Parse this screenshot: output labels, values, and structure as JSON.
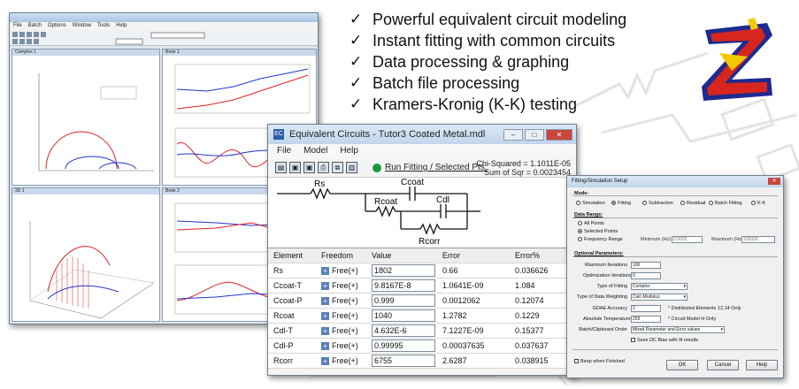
{
  "features": [
    "Powerful equivalent circuit modeling",
    "Instant fitting with common circuits",
    "Data processing & graphing",
    "Batch file processing",
    "Kramers-Kronig (K-K) testing"
  ],
  "check_glyph": "✓",
  "logo": {
    "letter": "Z",
    "colors": {
      "red": "#d7261e",
      "yellow": "#f3c900",
      "blue": "#1e2a8f"
    }
  },
  "app_window": {
    "menu": [
      "File",
      "Batch",
      "Options",
      "Window",
      "Tools",
      "Help"
    ],
    "panes": [
      "Complex 1",
      "Bode 1",
      "3D 1",
      "Bode 2"
    ]
  },
  "ec_window": {
    "title": "Equivalent Circuits - Tutor3 Coated Metal.mdl",
    "menu": [
      "File",
      "Model",
      "Help"
    ],
    "run_label": "Run Fitting / Selected Pts.",
    "chi_squared": "Chi-Squared = 1.1011E-05",
    "sum_sqr": "Sum of Sqr = 0.0023454",
    "circuit_labels": {
      "rs": "Rs",
      "ccoat": "Ccoat",
      "rcoat": "Rcoat",
      "cdl": "Cdl",
      "rcorr": "Rcorr"
    },
    "columns": [
      "Element",
      "Freedom",
      "Value",
      "Error",
      "Error%"
    ],
    "rows": [
      {
        "element": "Rs",
        "freedom": "Free(+)",
        "value": "1802",
        "error": "0.66",
        "error_pct": "0.036626"
      },
      {
        "element": "Ccoat-T",
        "freedom": "Free(+)",
        "value": "9.8167E-8",
        "error": "1.0641E-09",
        "error_pct": "1.084"
      },
      {
        "element": "Ccoat-P",
        "freedom": "Free(+)",
        "value": "0.999",
        "error": "0.0012062",
        "error_pct": "0.12074"
      },
      {
        "element": "Rcoat",
        "freedom": "Free(+)",
        "value": "1040",
        "error": "1.2782",
        "error_pct": "0.1229"
      },
      {
        "element": "Cdl-T",
        "freedom": "Free(+)",
        "value": "4.632E-6",
        "error": "7.1227E-09",
        "error_pct": "0.15377"
      },
      {
        "element": "Cdl-P",
        "freedom": "Free(+)",
        "value": "0.99995",
        "error": "0.00037635",
        "error_pct": "0.037637"
      },
      {
        "element": "Rcorr",
        "freedom": "Free(+)",
        "value": "6755",
        "error": "2.6287",
        "error_pct": "0.038915"
      }
    ]
  },
  "fit_dialog": {
    "title": "Fitting/Simulation Setup",
    "mode_label": "Mode:",
    "modes": [
      "Simulation",
      "Fitting",
      "Subtraction",
      "Residual",
      "Batch Fitting",
      "K-K"
    ],
    "selected_mode": "Fitting",
    "data_range_label": "Data Range:",
    "range_options": [
      "All Points",
      "Selected Points",
      "Frequency Range"
    ],
    "selected_range": "Selected Points",
    "min_hz_label": "Minimum (Hz)",
    "min_hz": "0.0025",
    "max_hz_label": "Maximum (Hz)",
    "max_hz": "100000",
    "optional_label": "Optional Parameters:",
    "max_iter_label": "Maximum Iterations",
    "max_iter": "100",
    "opt_iter_label": "Optimization Iterations",
    "opt_iter": "0",
    "fit_type_label": "Type of Fitting",
    "fit_type": "Complex",
    "weight_label": "Type of Data Weighting",
    "weight": "Calc-Modulus",
    "gdae_label": "GDAE Accuracy",
    "gdae": "2",
    "gdae_note": "* Distributed Elements 12,14 Only",
    "temp_label": "Absolute Temperature",
    "temp": "293",
    "temp_note": "* Circuit Model H Only",
    "batch_label": "Batch/Clipboard Order",
    "batch": "Mixed Parameter and Error values",
    "dc_bias": "Save DC Bias with fit results",
    "beep": "Beep when Finished",
    "ok": "OK",
    "cancel": "Cancel",
    "help": "Help"
  }
}
